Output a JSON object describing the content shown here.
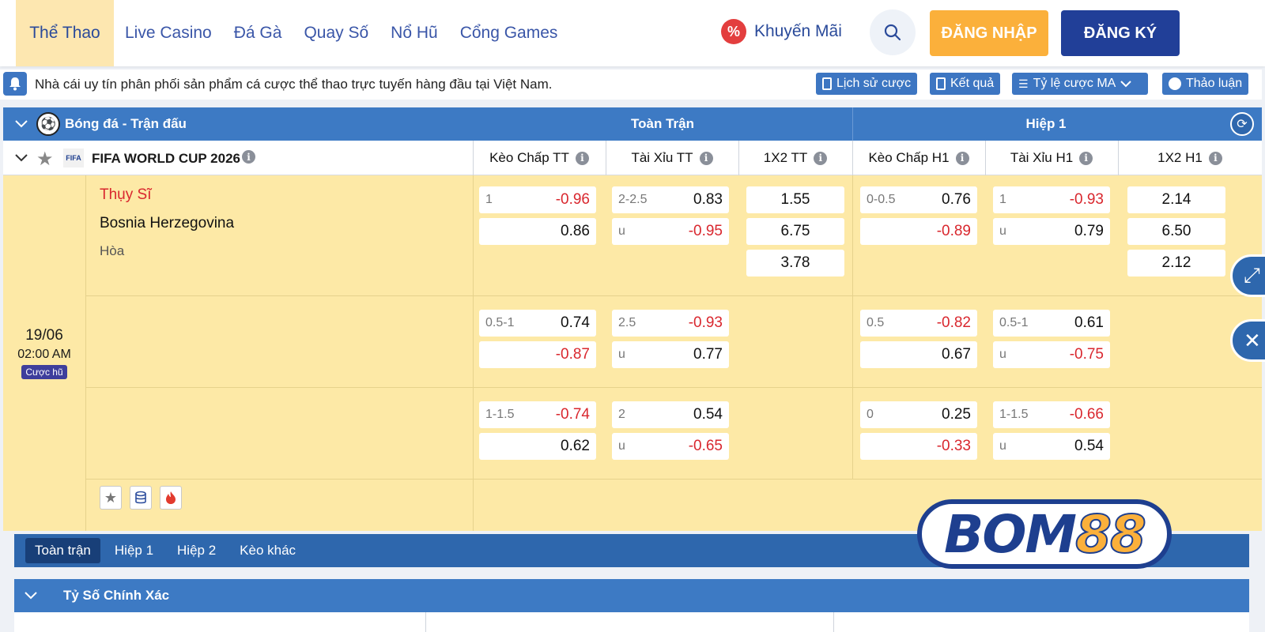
{
  "nav": {
    "items": [
      {
        "label": "Thể Thao",
        "active": true
      },
      {
        "label": "Live Casino"
      },
      {
        "label": "Đá Gà"
      },
      {
        "label": "Quay Số"
      },
      {
        "label": "Nổ Hũ"
      },
      {
        "label": "Cổng Games"
      }
    ],
    "promo_label": "Khuyến Mãi",
    "login_label": "ĐĂNG NHẬP",
    "register_label": "ĐĂNG KÝ"
  },
  "notice": {
    "text": "Nhà cái uy tín phân phối sản phẩm cá cược thể thao trực tuyến hàng đầu tại Việt Nam.",
    "history_label": "Lịch sử cược",
    "results_label": "Kết quả",
    "odds_label": "Tỷ lệ cược MA",
    "discuss_label": "Thảo luận"
  },
  "table": {
    "sport_title": "Bóng đá - Trận đấu",
    "full_match_label": "Toàn Trận",
    "half1_label": "Hiệp 1",
    "league": "FIFA WORLD CUP 2026",
    "league_logo_text": "FIFA",
    "columns": [
      "Kèo Chấp TT",
      "Tài Xỉu TT",
      "1X2 TT",
      "Kèo Chấp H1",
      "Tài Xỉu H1",
      "1X2 H1"
    ],
    "match": {
      "date": "19/06",
      "time": "02:00 AM",
      "badge": "Cược hũ",
      "home": "Thụy Sĩ",
      "away": "Bosnia Herzegovina",
      "draw": "Hòa"
    },
    "rows": [
      {
        "hdp_tt": {
          "line": "1",
          "home": "-0.96",
          "away": "0.86"
        },
        "ou_tt": {
          "line": "2-2.5",
          "over": "0.83",
          "under_label": "u",
          "under": "-0.95"
        },
        "x12_tt": [
          "1.55",
          "6.75",
          "3.78"
        ],
        "hdp_h1": {
          "line": "0-0.5",
          "home": "0.76",
          "away": "-0.89"
        },
        "ou_h1": {
          "line": "1",
          "over": "-0.93",
          "under_label": "u",
          "under": "0.79"
        },
        "x12_h1": [
          "2.14",
          "6.50",
          "2.12"
        ]
      },
      {
        "hdp_tt": {
          "line": "0.5-1",
          "home": "0.74",
          "away": "-0.87"
        },
        "ou_tt": {
          "line": "2.5",
          "over": "-0.93",
          "under_label": "u",
          "under": "0.77"
        },
        "hdp_h1": {
          "line": "0.5",
          "home": "-0.82",
          "away": "0.67"
        },
        "ou_h1": {
          "line": "0.5-1",
          "over": "0.61",
          "under_label": "u",
          "under": "-0.75"
        }
      },
      {
        "hdp_tt": {
          "line": "1-1.5",
          "home": "-0.74",
          "away": "0.62"
        },
        "ou_tt": {
          "line": "2",
          "over": "0.54",
          "under_label": "u",
          "under": "-0.65"
        },
        "hdp_h1": {
          "line": "0",
          "home": "0.25",
          "away": "-0.33"
        },
        "ou_h1": {
          "line": "1-1.5",
          "over": "-0.66",
          "under_label": "u",
          "under": "0.54"
        }
      }
    ]
  },
  "tabs": [
    {
      "label": "Toàn trận",
      "active": true
    },
    {
      "label": "Hiệp 1"
    },
    {
      "label": "Hiệp 2"
    },
    {
      "label": "Kèo khác"
    }
  ],
  "score_section_title": "Tỷ Số Chính Xác",
  "logo": {
    "text_main": "BOM",
    "text_num": "88"
  },
  "colors": {
    "primary_blue": "#3d7ac4",
    "dark_blue": "#213f98",
    "orange": "#fbb03b",
    "row_yellow": "#fde9a6",
    "negative_red": "#d9272e"
  }
}
